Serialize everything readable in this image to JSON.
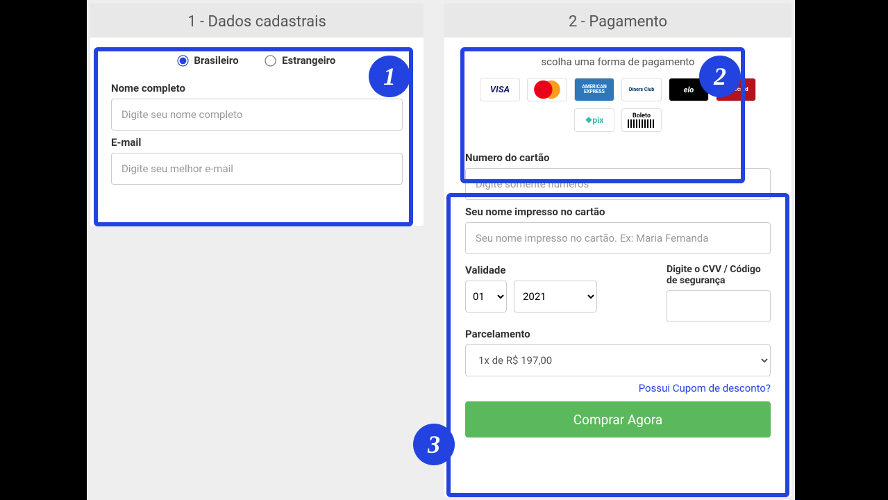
{
  "step1": {
    "title": "1 - Dados cadastrais",
    "nationality": {
      "brazilian": "Brasileiro",
      "foreigner": "Estrangeiro"
    },
    "name_label": "Nome completo",
    "name_placeholder": "Digite seu nome completo",
    "email_label": "E-mail",
    "email_placeholder": "Digite seu melhor e-mail"
  },
  "step2": {
    "title": "2 - Pagamento",
    "instruction": "scolha uma forma de pagamento",
    "methods": {
      "visa": "VISA",
      "mastercard": "MasterCard",
      "amex": "AMERICAN EXPRESS",
      "diners": "Diners Club",
      "elo": "elo",
      "hipercard": "Hipercard",
      "pix": "❖pix",
      "boleto": "Boleto"
    },
    "card_number_label": "Numero do cartão",
    "card_number_placeholder": "Digite somente números",
    "card_name_label": "Seu nome impresso no cartão",
    "card_name_placeholder": "Seu nome impresso no cartão. Ex: Maria Fernanda",
    "validity_label": "Validade",
    "validity_month": "01",
    "validity_year": "2021",
    "cvv_label": "Digite o CVV / Código de segurança",
    "installments_label": "Parcelamento",
    "installments_value": "1x de R$ 197,00",
    "coupon_link": "Possui Cupom de desconto?",
    "buy_button": "Comprar Agora"
  },
  "badges": {
    "one": "1",
    "two": "2",
    "three": "3"
  }
}
